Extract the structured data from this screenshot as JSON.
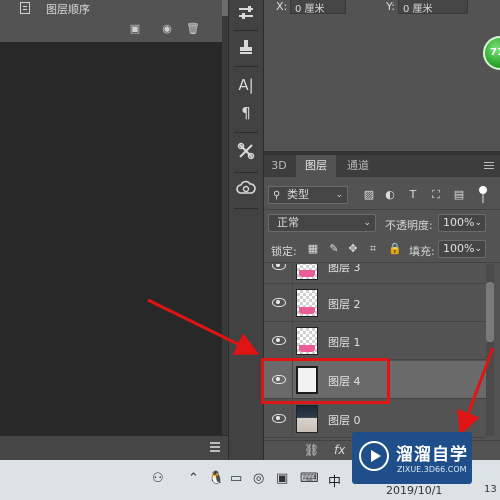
{
  "left_panel": {
    "doc_title": "图层顺序"
  },
  "info_panel": {
    "x_label": "X:",
    "x_value": "0 厘米",
    "y_label": "Y:",
    "y_value": "0 厘米",
    "badge": "71"
  },
  "layers_panel": {
    "tabs": [
      {
        "label": "3D",
        "active": false
      },
      {
        "label": "图层",
        "active": true
      },
      {
        "label": "通道",
        "active": false
      }
    ],
    "filter_kind": "类型",
    "blend_mode": "正常",
    "opacity_label": "不透明度:",
    "opacity_value": "100%",
    "lock_label": "锁定:",
    "fill_label": "填充:",
    "fill_value": "100%",
    "partial_top_layer": "图层 3",
    "layers": [
      {
        "name": "图层 2",
        "selected": false,
        "thumb": "pink-shape"
      },
      {
        "name": "图层 1",
        "selected": false,
        "thumb": "pink-shape"
      },
      {
        "name": "图层 4",
        "selected": true,
        "thumb": "frame"
      },
      {
        "name": "图层 0",
        "selected": false,
        "thumb": "photo"
      }
    ],
    "footer_fx": "fx"
  },
  "taskbar": {
    "lang": "中",
    "date": "2019/10/1",
    "corner": "13"
  },
  "watermark": {
    "title": "溜溜自学",
    "url": "ZIXUE.3D66.COM"
  },
  "colors": {
    "panel": "#535353",
    "dark_canvas": "#282828",
    "highlight": "#e01414",
    "pink": "#ea5d98",
    "watermark_bg": "#1f4f8a"
  }
}
